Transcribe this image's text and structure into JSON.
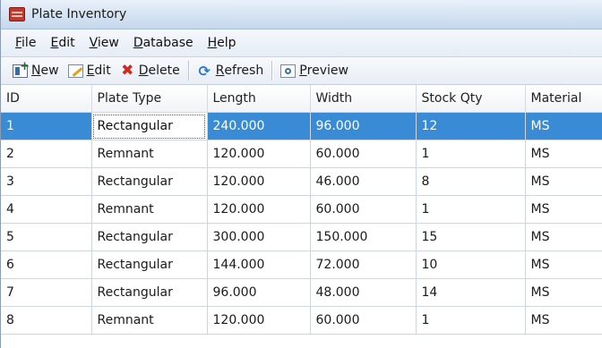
{
  "window": {
    "title": "Plate Inventory",
    "icon": "plate-app-icon"
  },
  "menu": [
    {
      "mnemonic": "F",
      "rest": "ile"
    },
    {
      "mnemonic": "E",
      "rest": "dit"
    },
    {
      "mnemonic": "V",
      "rest": "iew"
    },
    {
      "mnemonic": "D",
      "rest": "atabase"
    },
    {
      "mnemonic": "H",
      "rest": "elp"
    }
  ],
  "toolbar": {
    "new": {
      "mnemonic": "N",
      "rest": "ew"
    },
    "edit": {
      "mnemonic": "E",
      "rest": "dit"
    },
    "delete": {
      "mnemonic": "D",
      "rest": "elete"
    },
    "refresh": {
      "mnemonic": "R",
      "rest": "efresh"
    },
    "preview": {
      "mnemonic": "P",
      "rest": "review"
    }
  },
  "table": {
    "columns": [
      "ID",
      "Plate Type",
      "Length",
      "Width",
      "Stock Qty",
      "Material"
    ],
    "rows": [
      [
        "1",
        "Rectangular",
        "240.000",
        "96.000",
        "12",
        "MS"
      ],
      [
        "2",
        "Remnant",
        "120.000",
        "60.000",
        "1",
        "MS"
      ],
      [
        "3",
        "Rectangular",
        "120.000",
        "46.000",
        "8",
        "MS"
      ],
      [
        "4",
        "Remnant",
        "120.000",
        "60.000",
        "1",
        "MS"
      ],
      [
        "5",
        "Rectangular",
        "300.000",
        "150.000",
        "15",
        "MS"
      ],
      [
        "6",
        "Rectangular",
        "144.000",
        "72.000",
        "10",
        "MS"
      ],
      [
        "7",
        "Rectangular",
        "96.000",
        "48.000",
        "14",
        "MS"
      ],
      [
        "8",
        "Remnant",
        "120.000",
        "60.000",
        "1",
        "MS"
      ]
    ],
    "selected_row": 0,
    "focused_column": 1
  },
  "colors": {
    "selection": "#3a8bd6",
    "grid_line": "#cfd5dd"
  }
}
